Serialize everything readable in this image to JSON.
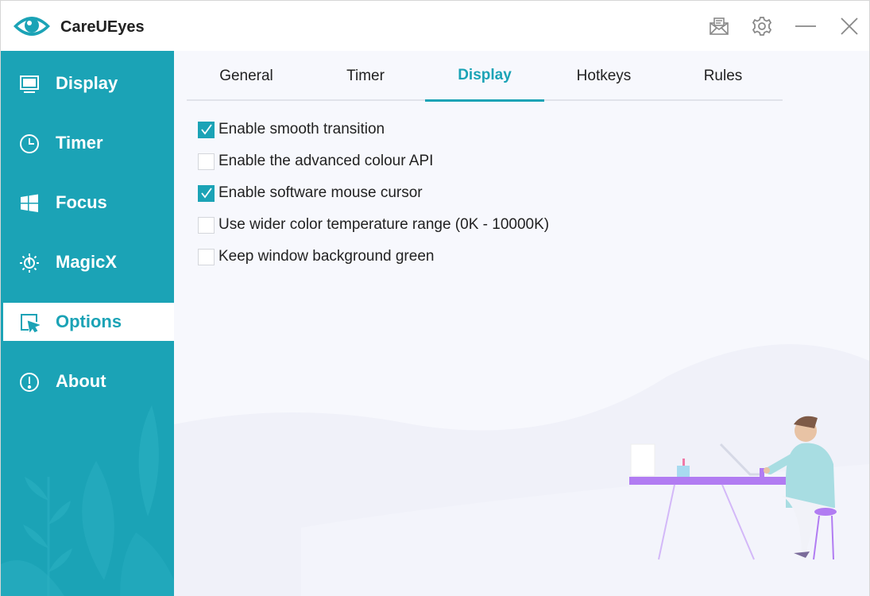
{
  "app": {
    "title": "CareUEyes"
  },
  "titlebar": {
    "icons": [
      "mail-icon",
      "gear-icon",
      "minimize-icon",
      "close-icon"
    ]
  },
  "sidebar": {
    "items": [
      {
        "label": "Display",
        "icon": "monitor-icon",
        "active": false
      },
      {
        "label": "Timer",
        "icon": "clock-icon",
        "active": false
      },
      {
        "label": "Focus",
        "icon": "windows-icon",
        "active": false
      },
      {
        "label": "MagicX",
        "icon": "sun-icon",
        "active": false
      },
      {
        "label": "Options",
        "icon": "cursor-icon",
        "active": true
      },
      {
        "label": "About",
        "icon": "info-icon",
        "active": false
      }
    ]
  },
  "tabs": [
    {
      "label": "General",
      "active": false
    },
    {
      "label": "Timer",
      "active": false
    },
    {
      "label": "Display",
      "active": true
    },
    {
      "label": "Hotkeys",
      "active": false
    },
    {
      "label": "Rules",
      "active": false
    }
  ],
  "options": [
    {
      "label": "Enable smooth transition",
      "checked": true
    },
    {
      "label": "Enable the advanced colour API",
      "checked": false
    },
    {
      "label": "Enable software mouse cursor",
      "checked": true
    },
    {
      "label": "Use wider color temperature range (0K - 10000K)",
      "checked": false
    },
    {
      "label": "Keep window background green",
      "checked": false
    }
  ],
  "colors": {
    "accent": "#1ba3b6",
    "text": "#222222",
    "content_bg": "#f7f8fd"
  }
}
